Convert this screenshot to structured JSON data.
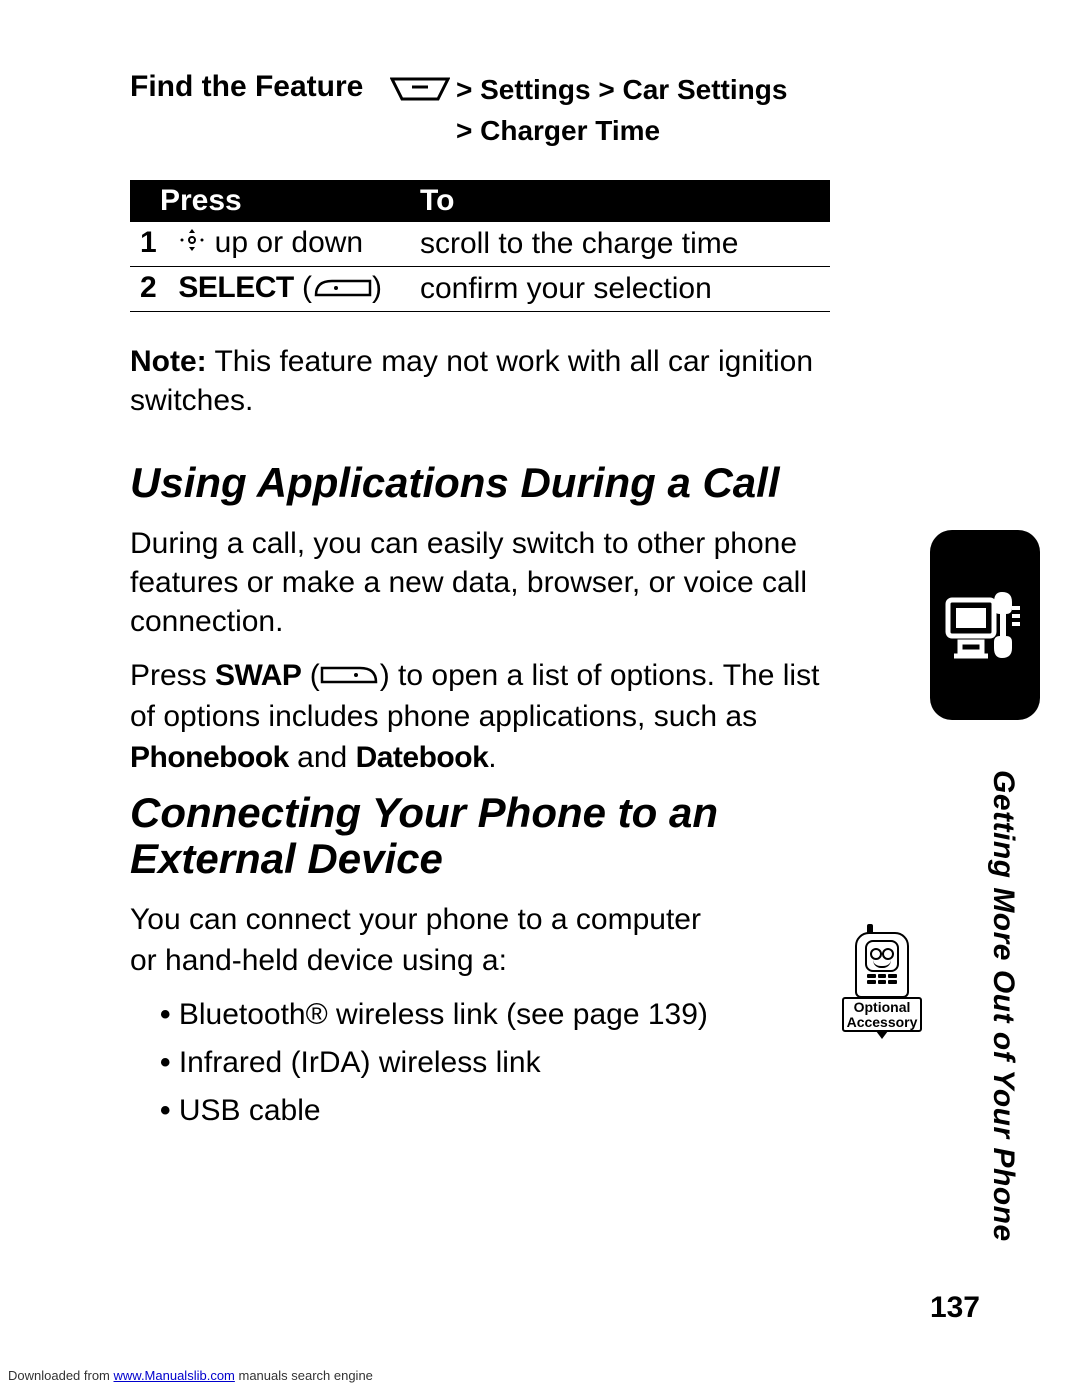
{
  "find": {
    "label": "Find the Feature",
    "path_line1_text": "> Settings > Car Settings",
    "path_line2_text": "> Charger Time"
  },
  "table": {
    "headers": {
      "press": "Press",
      "to": "To"
    },
    "rows": [
      {
        "num": "1",
        "press_suffix": " up or down",
        "to": "scroll to the charge time"
      },
      {
        "num": "2",
        "press_label": "SELECT",
        "to": "confirm your selection"
      }
    ]
  },
  "note": {
    "label": "Note:",
    "text": " This feature may not work with all car ignition switches."
  },
  "section1": {
    "heading": "Using Applications During a Call",
    "para1": "During a call, you can easily switch to other phone features or make a new data, browser, or voice call connection.",
    "para2_pre": "Press ",
    "para2_swap": "SWAP",
    "para2_mid": " to open a list of options. The list of options includes phone applications, such as ",
    "para2_app1": "Phonebook",
    "para2_and": " and ",
    "para2_app2": "Datebook",
    "para2_end": "."
  },
  "section2": {
    "heading": "Connecting Your Phone to an External Device",
    "para": "You can connect your phone to a computer or hand-held device using a:",
    "bullets": [
      "Bluetooth® wireless link (see page 139)",
      "Infrared (IrDA) wireless link",
      "USB cable"
    ]
  },
  "accessory": {
    "line1": "Optional",
    "line2": "Accessory"
  },
  "side_label": "Getting More Out of Your Phone",
  "page_number": "137",
  "footer": {
    "pre": "Downloaded from ",
    "link": "www.Manualslib.com",
    "post": " manuals search engine"
  }
}
